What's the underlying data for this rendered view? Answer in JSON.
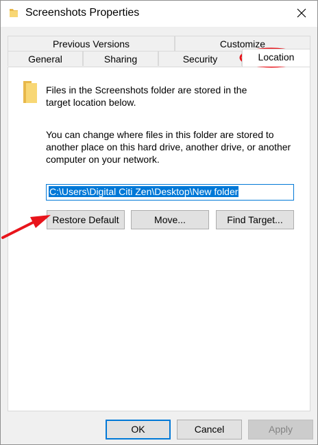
{
  "window": {
    "title": "Screenshots Properties"
  },
  "tabs_back": [
    {
      "label": "Previous Versions"
    },
    {
      "label": "Customize"
    }
  ],
  "tabs_front": [
    {
      "label": "General"
    },
    {
      "label": "Sharing"
    },
    {
      "label": "Security"
    },
    {
      "label": "Location",
      "active": true
    }
  ],
  "location": {
    "intro": "Files in the Screenshots folder are stored in the target location below.",
    "explanation": "You can change where files in this folder are stored to another place on this hard drive, another drive, or another computer on your network.",
    "path_value": "C:\\Users\\Digital Citi Zen\\Desktop\\New folder",
    "buttons": {
      "restore_default": "Restore Default",
      "move": "Move...",
      "find_target": "Find Target..."
    }
  },
  "footer": {
    "ok": "OK",
    "cancel": "Cancel",
    "apply": "Apply"
  },
  "colors": {
    "accent": "#0078d7",
    "annotation_red": "#e8141b",
    "folder": "#f8d775"
  },
  "icons": [
    "folder-icon",
    "close-icon",
    "arrow-annotation"
  ]
}
